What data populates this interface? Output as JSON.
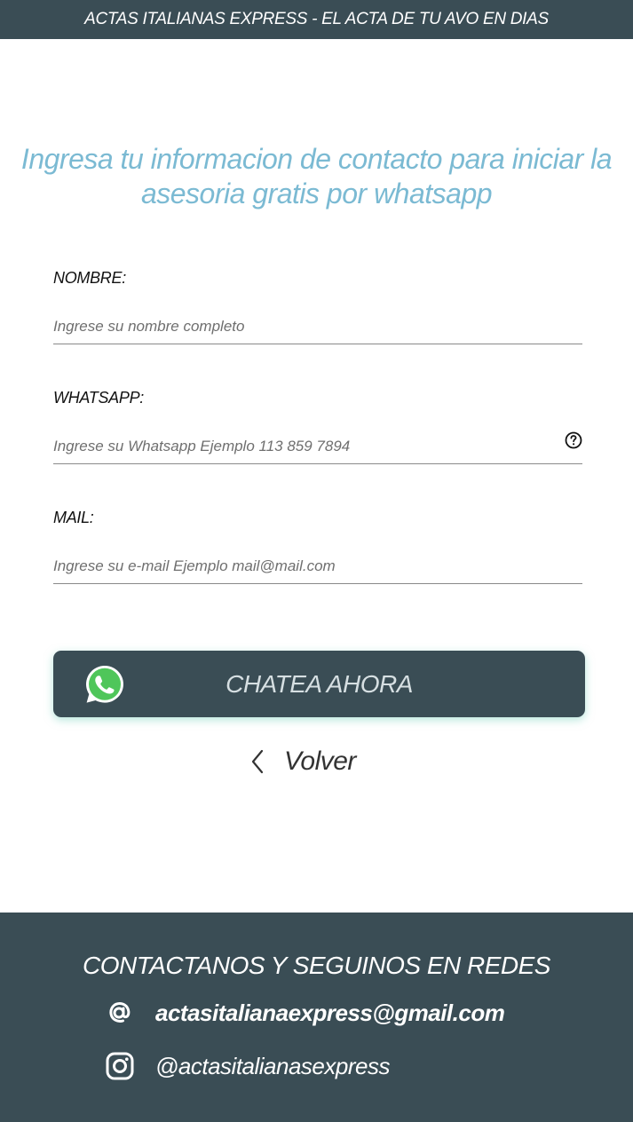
{
  "header": {
    "banner": "ACTAS ITALIANAS EXPRESS - EL ACTA DE TU AVO EN DIAS"
  },
  "main": {
    "headline": "Ingresa tu informacion de contacto para iniciar la asesoria gratis por whatsapp"
  },
  "form": {
    "name": {
      "label": "NOMBRE:",
      "placeholder": "Ingrese su nombre completo",
      "value": ""
    },
    "whatsapp": {
      "label": "WHATSAPP:",
      "placeholder": "Ingrese su Whatsapp Ejemplo 113 859 7894",
      "value": "",
      "help_icon": "question-circle-icon"
    },
    "mail": {
      "label": "MAIL:",
      "placeholder": "Ingrese su e-mail Ejemplo mail@mail.com",
      "value": ""
    },
    "submit_label": "CHATEA AHORA",
    "submit_icon": "whatsapp-icon",
    "back_label": "Volver",
    "back_icon": "chevron-left-icon"
  },
  "footer": {
    "title": "CONTACTANOS Y SEGUINOS EN REDES",
    "email": "actasitalianaexpress@gmail.com",
    "email_icon": "at-sign-icon",
    "instagram": "@actasitalianasexpress",
    "instagram_icon": "instagram-icon"
  },
  "colors": {
    "dark_slate": "#3a4d55",
    "headline_blue": "#7bbad3",
    "whatsapp_green": "#4fc65a",
    "button_glow": "#78d2be"
  }
}
